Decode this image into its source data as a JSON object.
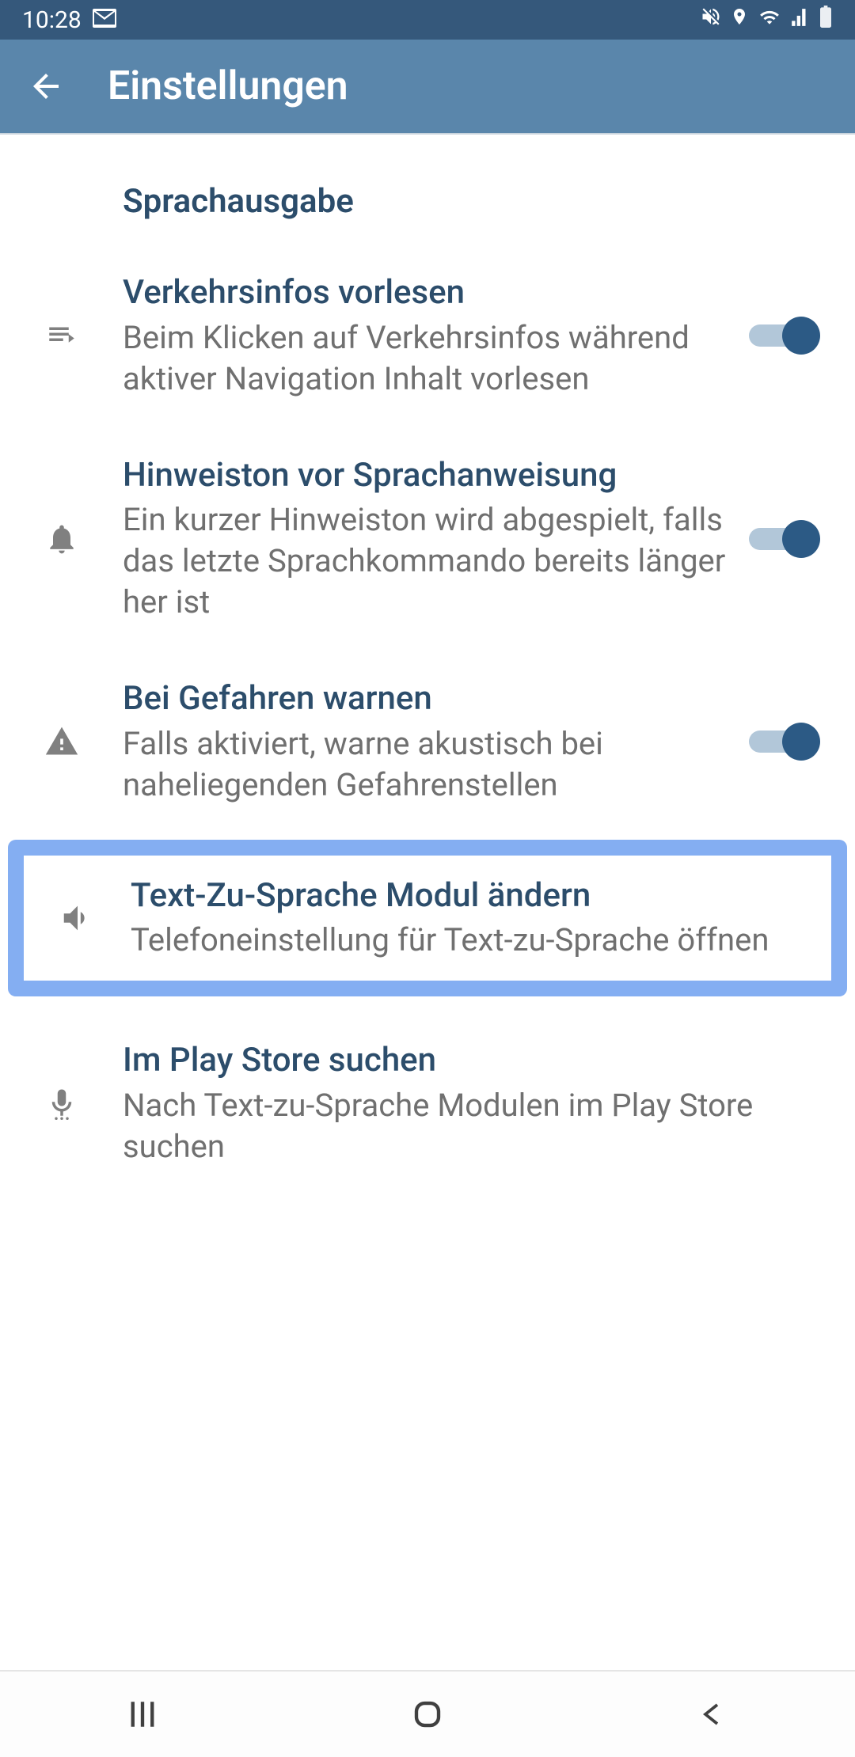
{
  "status": {
    "time": "10:28"
  },
  "header": {
    "title": "Einstellungen"
  },
  "section": {
    "title": "Sprachausgabe"
  },
  "items": [
    {
      "title": "Verkehrsinfos vorlesen",
      "desc": "Beim Klicken auf Verkehrs­infos während aktiver Navigation Inhalt vorlesen"
    },
    {
      "title": "Hinweiston vor Sprachanweisung",
      "desc": "Ein kurzer Hinweiston wird abgespielt, falls das letzte Sprachkommando bereits länger her ist"
    },
    {
      "title": "Bei Gefahren warnen",
      "desc": "Falls aktiviert, warne akus­tisch bei naheliegenden Gefahrenstellen"
    },
    {
      "title": "Text-Zu-Sprache Modul ändern",
      "desc": "Telefoneinstellung für Text-zu-Sprache öffnen"
    },
    {
      "title": "Im Play Store suchen",
      "desc": "Nach Text-zu-Sprache Modulen im Play Store suchen"
    }
  ]
}
